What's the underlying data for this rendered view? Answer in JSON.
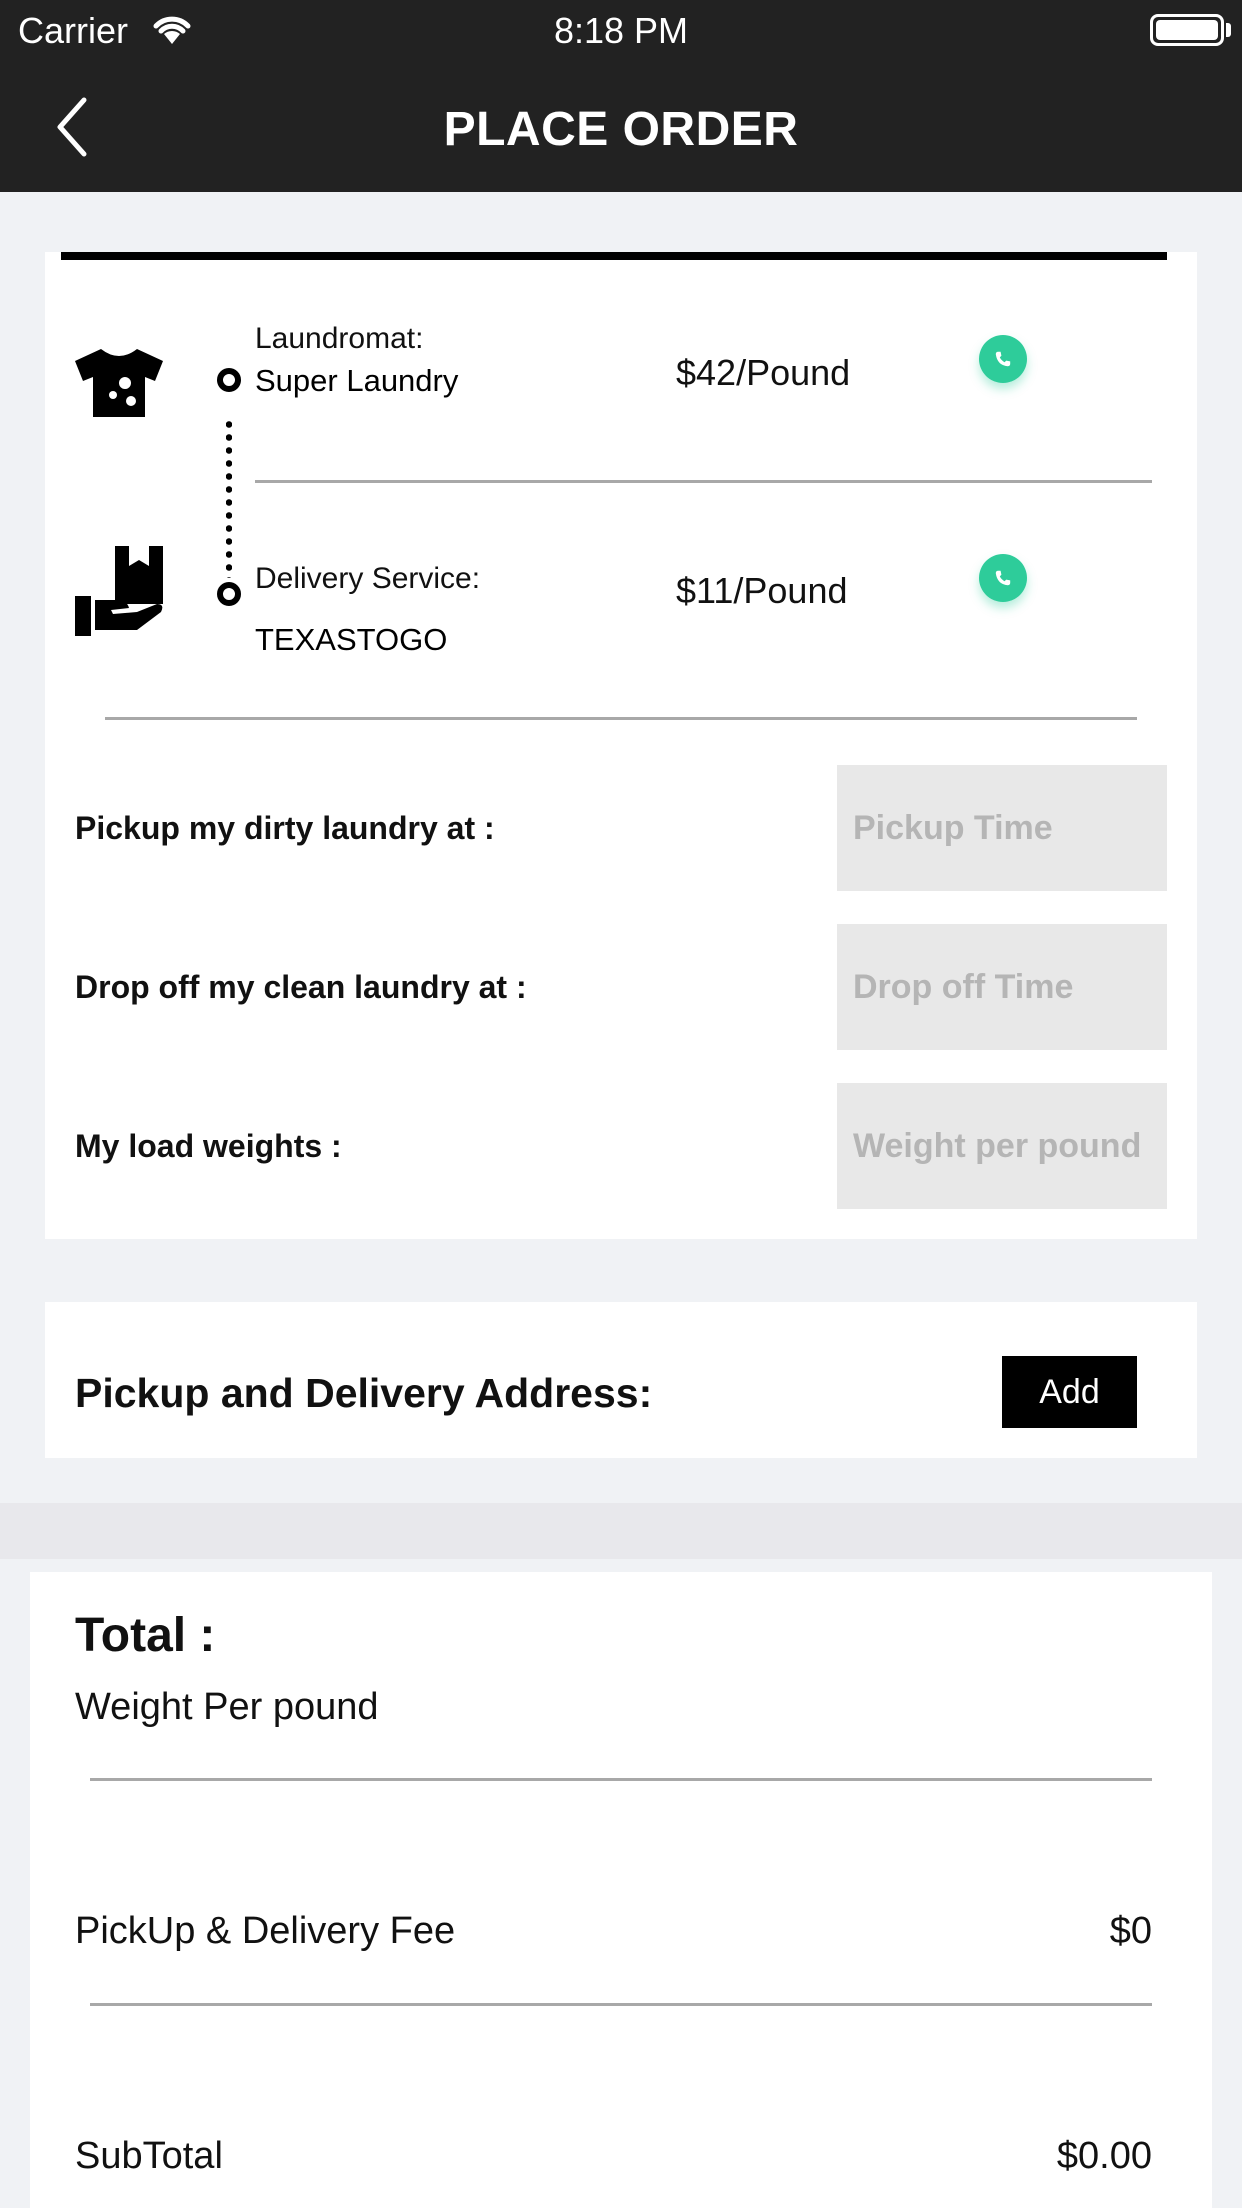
{
  "status_bar": {
    "carrier": "Carrier",
    "time": "8:18 PM"
  },
  "nav": {
    "title": "PLACE ORDER",
    "back_icon": "chevron-left-icon"
  },
  "services": [
    {
      "label": "Laundromat:",
      "name": "Super Laundry",
      "price": "$42/Pound",
      "icon": "tshirt-icon",
      "action_icon": "phone-icon"
    },
    {
      "label": "Delivery Service:",
      "name": "TEXASTOGO",
      "price": "$11/Pound",
      "icon": "hand-box-icon",
      "action_icon": "phone-icon"
    }
  ],
  "form": {
    "pickup_label": "Pickup my dirty laundry at :",
    "pickup_placeholder": "Pickup Time",
    "dropoff_label": "Drop off my clean laundry at :",
    "dropoff_placeholder": "Drop off Time",
    "weight_label": "My load weights :",
    "weight_placeholder": "Weight per pound"
  },
  "address": {
    "label": "Pickup and Delivery Address:",
    "add_label": "Add"
  },
  "total": {
    "title": "Total :",
    "weight_label": "Weight Per pound",
    "fee_label": "PickUp & Delivery Fee",
    "fee_value": "$0",
    "subtotal_label": "SubTotal",
    "subtotal_value": "$0.00"
  },
  "colors": {
    "header_bg": "#222222",
    "accent_green": "#2ecc9a",
    "page_bg": "#f0f2f5",
    "input_bg": "#e8e8e8"
  }
}
